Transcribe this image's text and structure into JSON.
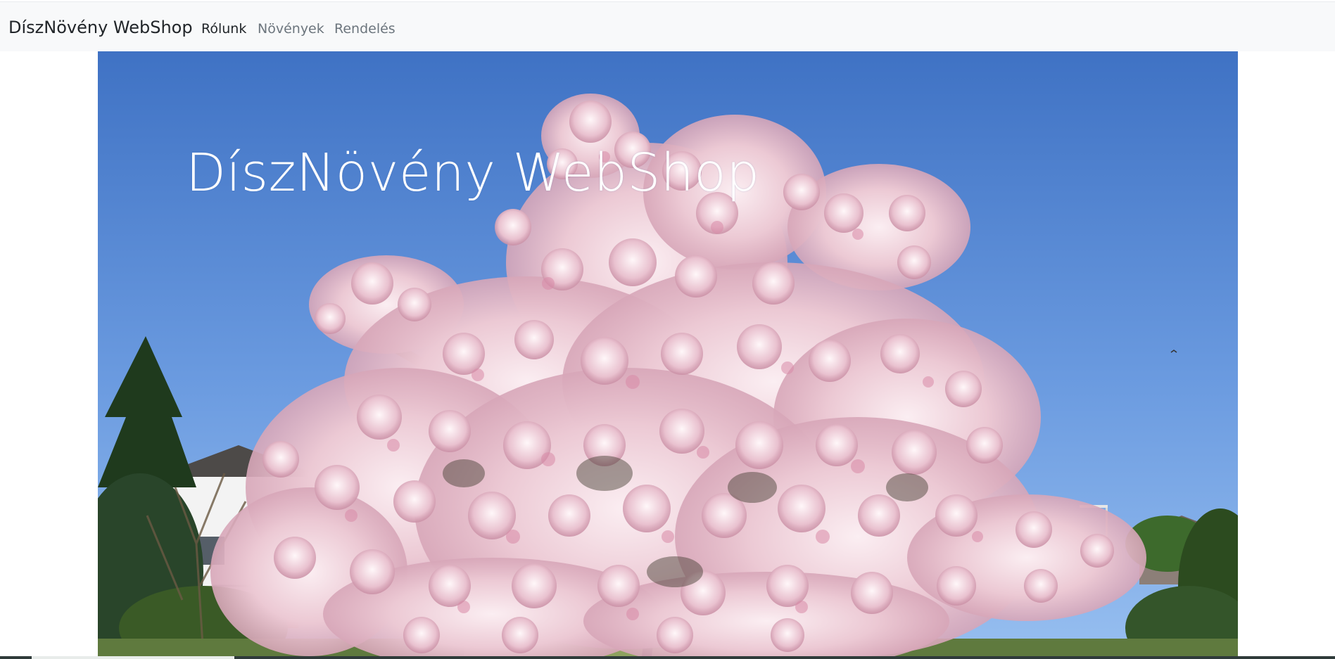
{
  "navbar": {
    "brand": "DíszNövény WebShop",
    "links": [
      {
        "label": "Rólunk",
        "active": true
      },
      {
        "label": "Növények",
        "active": false
      },
      {
        "label": "Rendelés",
        "active": false
      }
    ]
  },
  "hero": {
    "title": "DíszNövény WebShop",
    "image": "magnolia-tree-photo"
  },
  "colors": {
    "navbar_bg": "#f8f9fa",
    "sky_top": "#3f74c6",
    "sky_bottom": "#8fbbee",
    "blossom": "#f3dce3"
  }
}
